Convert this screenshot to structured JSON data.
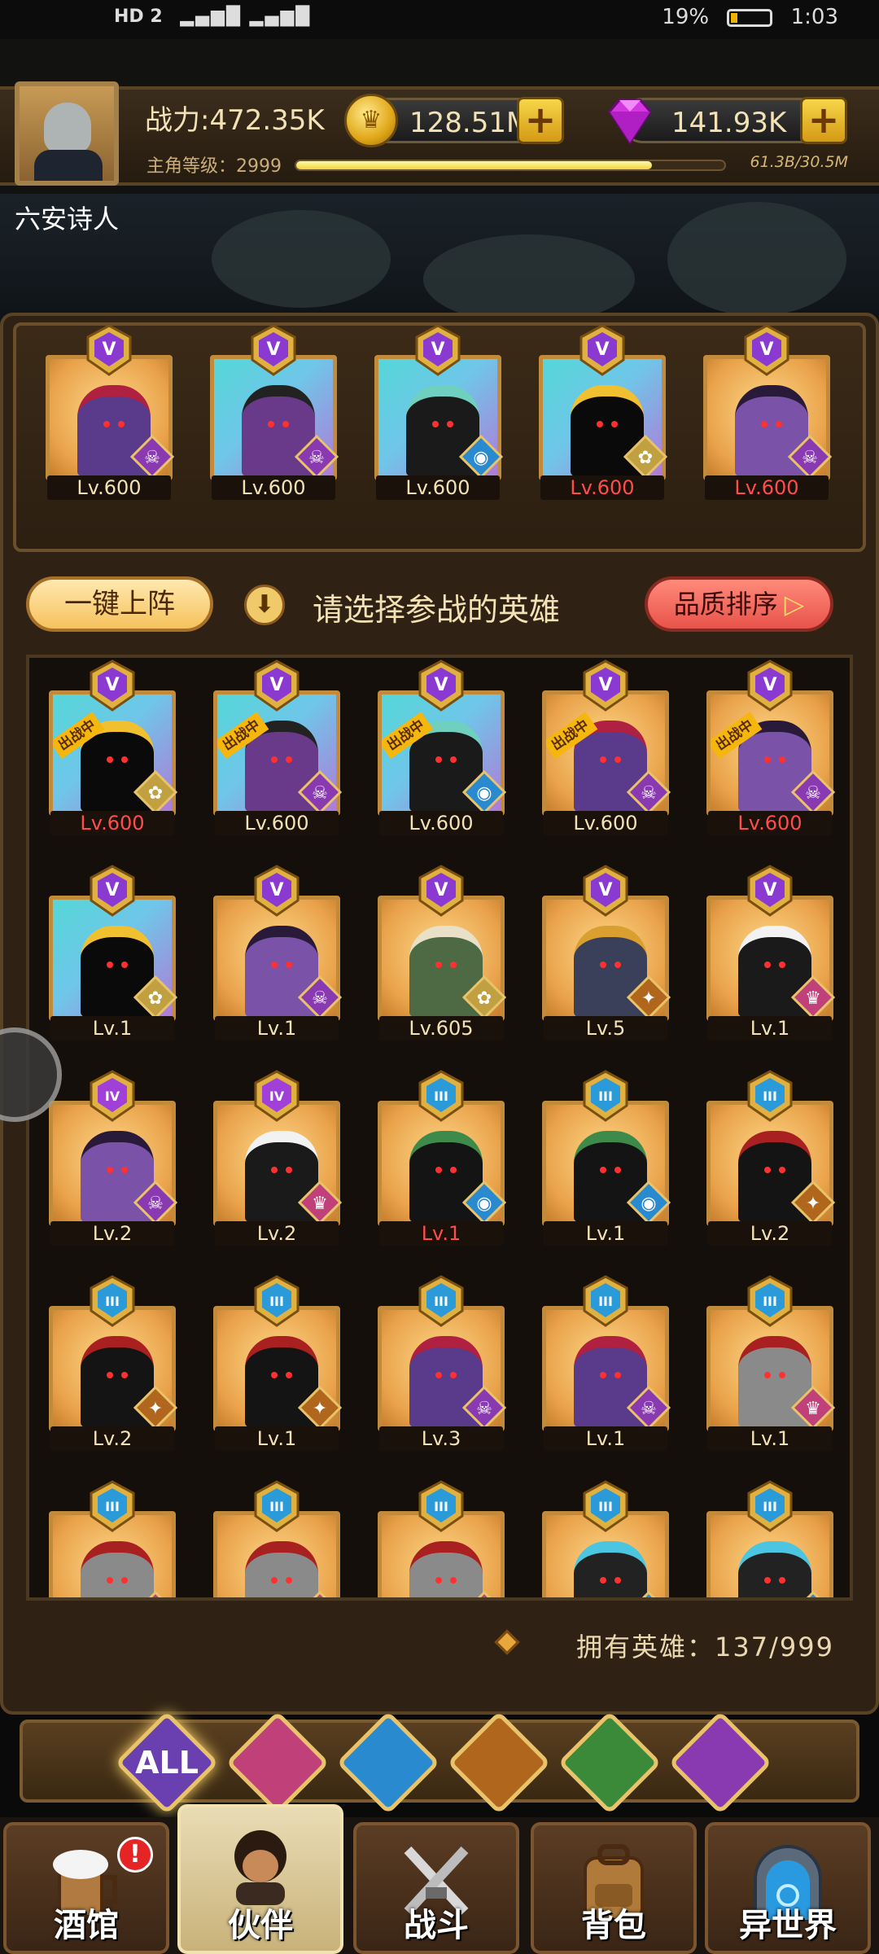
{
  "status_bar": {
    "left": "HD 2",
    "battery": "19%",
    "time": "1:03"
  },
  "header": {
    "power": "战力:472.35K",
    "gold": "128.51M",
    "gems": "141.93K",
    "level_label": "主角等级：2999",
    "level_progress": "61.3B/30.5M",
    "level_fill": 0.83
  },
  "username": "六安诗人",
  "team": [
    {
      "lv": "Lv.600",
      "lv_red": false,
      "bg": "gold",
      "rank": "V",
      "fig": "purple-crest",
      "class": "demon"
    },
    {
      "lv": "Lv.600",
      "lv_red": false,
      "bg": "cyan",
      "rank": "V",
      "fig": "purple-tall",
      "class": "demon"
    },
    {
      "lv": "Lv.600",
      "lv_red": false,
      "bg": "cyan",
      "rank": "V",
      "fig": "dark-crown",
      "class": "fish"
    },
    {
      "lv": "Lv.600",
      "lv_red": true,
      "bg": "cyan",
      "rank": "V",
      "fig": "shadow-gold",
      "class": "elf"
    },
    {
      "lv": "Lv.600",
      "lv_red": true,
      "bg": "gold",
      "rank": "V",
      "fig": "purple-horn",
      "class": "demon"
    }
  ],
  "actions": {
    "quick_deploy": "一键上阵",
    "hint": "请选择参战的英雄",
    "sort": "品质排序"
  },
  "deployed_tag": "出战中",
  "heroes": [
    {
      "lv": "Lv.600",
      "lv_red": true,
      "bg": "cyan",
      "rank": "V",
      "fig": "shadow-gold",
      "class": "elf",
      "deployed": true
    },
    {
      "lv": "Lv.600",
      "lv_red": false,
      "bg": "cyan",
      "rank": "V",
      "fig": "purple-tall",
      "class": "demon",
      "deployed": true
    },
    {
      "lv": "Lv.600",
      "lv_red": false,
      "bg": "cyan",
      "rank": "V",
      "fig": "dark-crown",
      "class": "fish",
      "deployed": true
    },
    {
      "lv": "Lv.600",
      "lv_red": false,
      "bg": "gold",
      "rank": "V",
      "fig": "purple-crest",
      "class": "demon",
      "deployed": true
    },
    {
      "lv": "Lv.600",
      "lv_red": true,
      "bg": "gold",
      "rank": "V",
      "fig": "purple-horn",
      "class": "demon",
      "deployed": true
    },
    {
      "lv": "Lv.1",
      "lv_red": false,
      "bg": "cyan",
      "rank": "V",
      "fig": "shadow-gold",
      "class": "elf",
      "deployed": false
    },
    {
      "lv": "Lv.1",
      "lv_red": false,
      "bg": "gold",
      "rank": "V",
      "fig": "purple-horn",
      "class": "demon",
      "deployed": false
    },
    {
      "lv": "Lv.605",
      "lv_red": false,
      "bg": "gold",
      "rank": "V",
      "fig": "green-elf",
      "class": "elf",
      "deployed": false
    },
    {
      "lv": "Lv.5",
      "lv_red": false,
      "bg": "gold",
      "rank": "V",
      "fig": "pharaoh",
      "class": "lion",
      "deployed": false
    },
    {
      "lv": "Lv.1",
      "lv_red": false,
      "bg": "gold",
      "rank": "V",
      "fig": "white-king",
      "class": "king",
      "deployed": false
    },
    {
      "lv": "Lv.2",
      "lv_red": false,
      "bg": "gold",
      "rank": "IV",
      "fig": "purple-horn",
      "class": "demon",
      "deployed": false
    },
    {
      "lv": "Lv.2",
      "lv_red": false,
      "bg": "gold",
      "rank": "IV",
      "fig": "white-king",
      "class": "king",
      "deployed": false
    },
    {
      "lv": "Lv.1",
      "lv_red": true,
      "bg": "gold",
      "rank": "III",
      "fig": "dark-green",
      "class": "fish",
      "deployed": false
    },
    {
      "lv": "Lv.1",
      "lv_red": false,
      "bg": "gold",
      "rank": "III",
      "fig": "dark-green",
      "class": "fish",
      "deployed": false
    },
    {
      "lv": "Lv.2",
      "lv_red": false,
      "bg": "gold",
      "rank": "III",
      "fig": "red-dark",
      "class": "lion",
      "deployed": false
    },
    {
      "lv": "Lv.2",
      "lv_red": false,
      "bg": "gold",
      "rank": "III",
      "fig": "red-dark",
      "class": "lion",
      "deployed": false
    },
    {
      "lv": "Lv.1",
      "lv_red": false,
      "bg": "gold",
      "rank": "III",
      "fig": "red-dark",
      "class": "lion",
      "deployed": false
    },
    {
      "lv": "Lv.3",
      "lv_red": false,
      "bg": "gold",
      "rank": "III",
      "fig": "purple-crest",
      "class": "demon",
      "deployed": false
    },
    {
      "lv": "Lv.1",
      "lv_red": false,
      "bg": "gold",
      "rank": "III",
      "fig": "purple-crest",
      "class": "demon",
      "deployed": false
    },
    {
      "lv": "Lv.1",
      "lv_red": false,
      "bg": "gold",
      "rank": "III",
      "fig": "silver-knight",
      "class": "king",
      "deployed": false
    },
    {
      "lv": "",
      "lv_red": false,
      "bg": "gold",
      "rank": "III",
      "fig": "silver-knight",
      "class": "king",
      "deployed": false
    },
    {
      "lv": "",
      "lv_red": false,
      "bg": "gold",
      "rank": "III",
      "fig": "silver-knight",
      "class": "king",
      "deployed": false
    },
    {
      "lv": "",
      "lv_red": false,
      "bg": "gold",
      "rank": "III",
      "fig": "silver-knight",
      "class": "king",
      "deployed": false
    },
    {
      "lv": "",
      "lv_red": false,
      "bg": "gold",
      "rank": "III",
      "fig": "cyan-hair",
      "class": "fish",
      "deployed": false
    },
    {
      "lv": "",
      "lv_red": false,
      "bg": "gold",
      "rank": "III",
      "fig": "cyan-hair",
      "class": "fish",
      "deployed": false
    }
  ],
  "owned": "拥有英雄：137/999",
  "filters": [
    {
      "label": "ALL",
      "icon": "all-filter-icon",
      "color": "#6a3fb0"
    },
    {
      "label": "",
      "icon": "king-filter-icon",
      "color": "#c0407a"
    },
    {
      "label": "",
      "icon": "fish-filter-icon",
      "color": "#2a8ad0"
    },
    {
      "label": "",
      "icon": "lion-filter-icon",
      "color": "#b0661c"
    },
    {
      "label": "",
      "icon": "elf-filter-icon",
      "color": "#3a8a3a"
    },
    {
      "label": "",
      "icon": "demon-filter-icon",
      "color": "#8a3ab0"
    }
  ],
  "nav": [
    {
      "label": "酒馆",
      "icon": "beer-mug-icon",
      "active": false,
      "alert": "!"
    },
    {
      "label": "伙伴",
      "icon": "companion-icon",
      "active": true,
      "alert": ""
    },
    {
      "label": "战斗",
      "icon": "crossed-swords-icon",
      "active": false,
      "alert": ""
    },
    {
      "label": "背包",
      "icon": "backpack-icon",
      "active": false,
      "alert": ""
    },
    {
      "label": "异世界",
      "icon": "portal-icon",
      "active": false,
      "alert": ""
    }
  ]
}
